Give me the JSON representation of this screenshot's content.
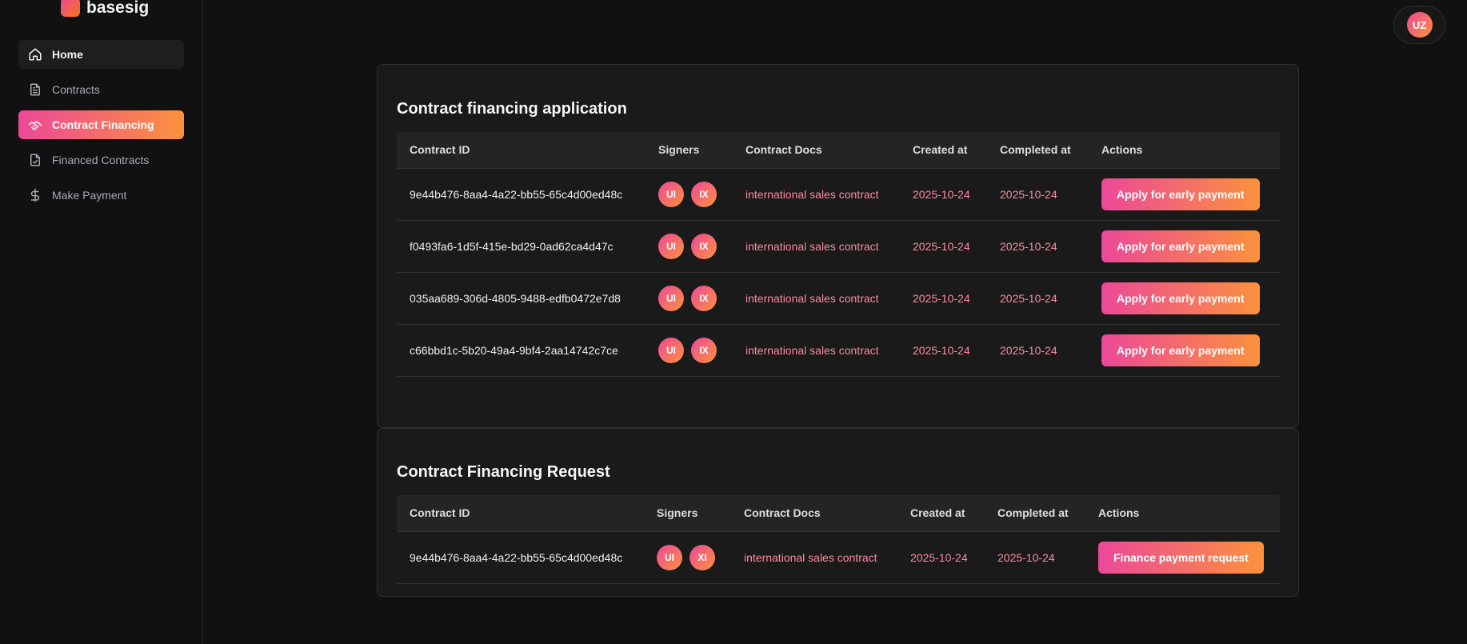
{
  "brand": {
    "name": "basesig"
  },
  "sidebar": {
    "items": [
      {
        "label": "Home",
        "icon": "home-icon"
      },
      {
        "label": "Contracts",
        "icon": "document-icon"
      },
      {
        "label": "Contract Financing",
        "icon": "handshake-icon"
      },
      {
        "label": "Financed Contracts",
        "icon": "file-check-icon"
      },
      {
        "label": "Make Payment",
        "icon": "dollar-icon"
      }
    ]
  },
  "user": {
    "initials": "UZ"
  },
  "colors": {
    "accent_start": "#ec4899",
    "accent_end": "#fb923c",
    "link_text": "#fb8aa0"
  },
  "application": {
    "title": "Contract financing application",
    "columns": [
      "Contract ID",
      "Signers",
      "Contract Docs",
      "Created at",
      "Completed at",
      "Actions"
    ],
    "rows": [
      {
        "id": "9e44b476-8aa4-4a22-bb55-65c4d00ed48c",
        "signers": [
          "UI",
          "IX"
        ],
        "doc": "international sales contract",
        "created": "2025-10-24",
        "completed": "2025-10-24",
        "action": "Apply for early payment"
      },
      {
        "id": "f0493fa6-1d5f-415e-bd29-0ad62ca4d47c",
        "signers": [
          "UI",
          "IX"
        ],
        "doc": "international sales contract",
        "created": "2025-10-24",
        "completed": "2025-10-24",
        "action": "Apply for early payment"
      },
      {
        "id": "035aa689-306d-4805-9488-edfb0472e7d8",
        "signers": [
          "UI",
          "IX"
        ],
        "doc": "international sales contract",
        "created": "2025-10-24",
        "completed": "2025-10-24",
        "action": "Apply for early payment"
      },
      {
        "id": "c66bbd1c-5b20-49a4-9bf4-2aa14742c7ce",
        "signers": [
          "UI",
          "IX"
        ],
        "doc": "international sales contract",
        "created": "2025-10-24",
        "completed": "2025-10-24",
        "action": "Apply for early payment"
      }
    ]
  },
  "request": {
    "title": "Contract Financing Request",
    "columns": [
      "Contract ID",
      "Signers",
      "Contract Docs",
      "Created at",
      "Completed at",
      "Actions"
    ],
    "rows": [
      {
        "id": "9e44b476-8aa4-4a22-bb55-65c4d00ed48c",
        "signers": [
          "UI",
          "XI"
        ],
        "doc": "international sales contract",
        "created": "2025-10-24",
        "completed": "2025-10-24",
        "action": "Finance payment request"
      }
    ]
  }
}
